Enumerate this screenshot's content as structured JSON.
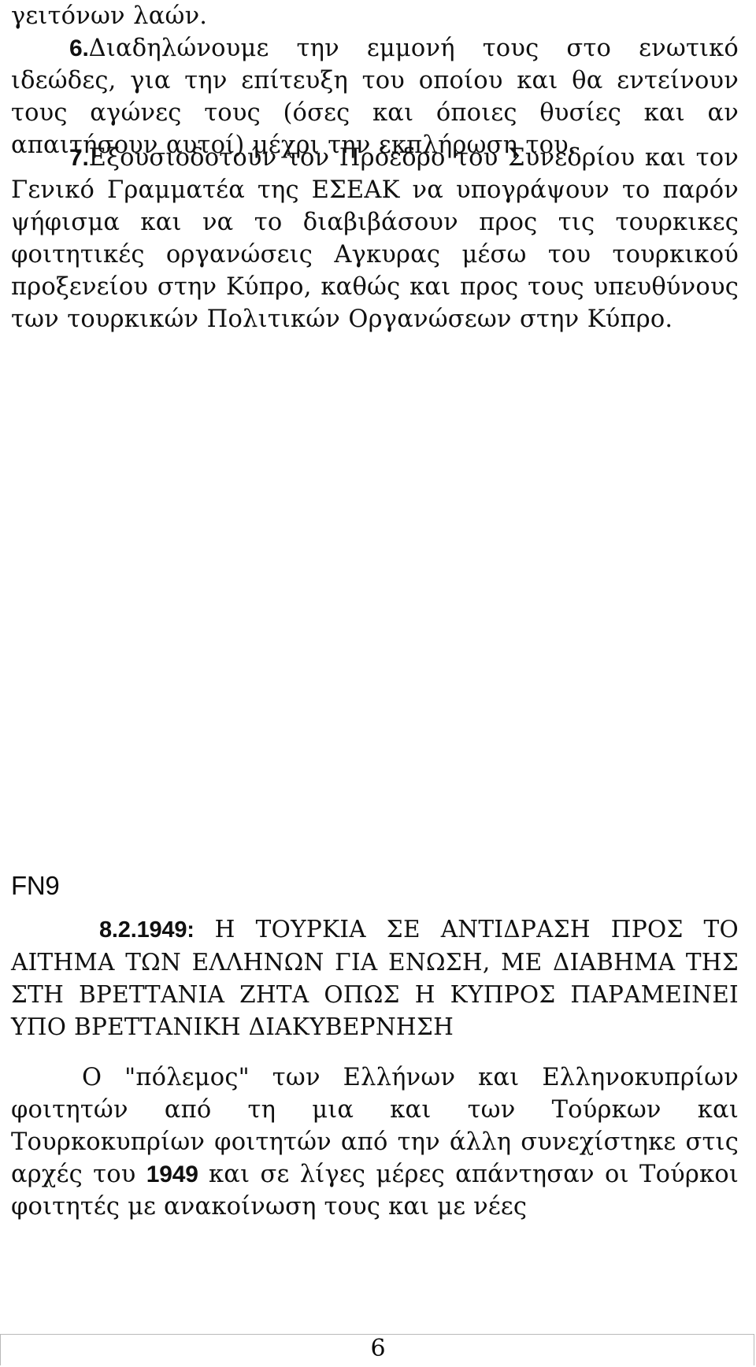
{
  "document": {
    "page_number": "6",
    "language": "el"
  },
  "body": {
    "block_1": {
      "opening_line": "γειτόνων λαών.",
      "item_number": "6.",
      "item_text": "Διαδηλώνουμε την εμμονή τους στο ενωτικό ιδεώδες, για την επίτευξη του οποίου και θα εντείνουν τους αγώνες τους (όσες και όποιες θυσίες και αν απαιτήσουν αυτοί) μέχρι την εκπλήρωση του."
    },
    "block_2": {
      "item_number": "7.",
      "item_text": "Εξουσιοδοτούν τον Πρόεδρο του Συνεδρίου και τον Γενικό Γραμματέα της ΕΣΕΑΚ να υπογράψουν το παρόν ψήφισμα και να το διαβιβάσουν προς τις τουρκικες φοιτητικές οργανώσεις Αγκυρας μέσω του τουρκικού προξενείου στην Κύπρο, καθώς και προς τους υπευθύνους των τουρκικών Πολιτικών Οργανώσεων στην Κύπρο."
    }
  },
  "footnote": {
    "marker": "FN9",
    "date": "8.2.1949:",
    "heading_text": "Η ΤΟΥΡΚΙΑ ΣΕ ΑΝΤΙΔΡΑΣΗ ΠΡΟΣ ΤΟ ΑΙΤΗΜΑ ΤΩΝ ΕΛΛΗΝΩΝ ΓΙΑ ΕΝΩΣΗ, ΜΕ ΔΙΑΒΗΜΑ ΤΗΣ ΣΤΗ ΒΡΕΤΤΑΝΙΑ ΖΗΤΑ ΟΠΩΣ Η ΚΥΠΡΟΣ ΠΑΡΑΜΕΙΝΕΙ ΥΠΟ ΒΡΕΤΤΑΝΙΚΗ ΔΙΑΚΥΒΕΡΝΗΣΗ"
  },
  "closing_paragraph": {
    "part_1": "Ο \"πόλεμος\" των Ελλήνων και Ελληνοκυπρίων φοιτητών από τη μια και των Τούρκων και Τουρκοκυπρίων φοιτητών από την άλλη συνεχίστηκε στις αρχές του ",
    "year": "1949",
    "part_2": " και σε λίγες μέρες απάντησαν οι Τούρκοι φοιτητές με ανακοίνωση τους και με νέες"
  }
}
